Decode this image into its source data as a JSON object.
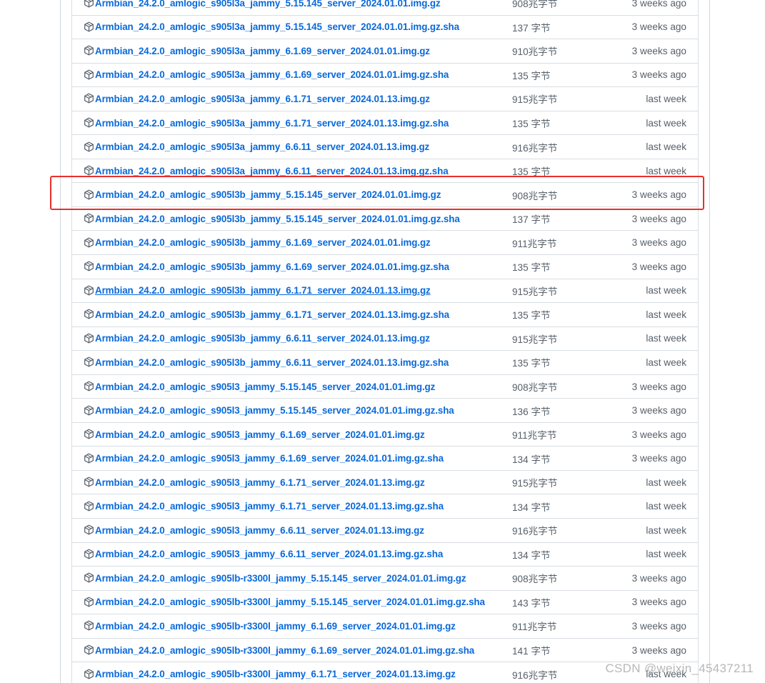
{
  "assets": [
    {
      "name": "Armbian_24.2.0_amlogic_s905l3a_jammy_5.15.145_server_2024.01.01.img.gz",
      "size": "908兆字节",
      "time": "3 weeks ago"
    },
    {
      "name": "Armbian_24.2.0_amlogic_s905l3a_jammy_5.15.145_server_2024.01.01.img.gz.sha",
      "size": "137 字节",
      "time": "3 weeks ago"
    },
    {
      "name": "Armbian_24.2.0_amlogic_s905l3a_jammy_6.1.69_server_2024.01.01.img.gz",
      "size": "910兆字节",
      "time": "3 weeks ago"
    },
    {
      "name": "Armbian_24.2.0_amlogic_s905l3a_jammy_6.1.69_server_2024.01.01.img.gz.sha",
      "size": "135 字节",
      "time": "3 weeks ago"
    },
    {
      "name": "Armbian_24.2.0_amlogic_s905l3a_jammy_6.1.71_server_2024.01.13.img.gz",
      "size": "915兆字节",
      "time": "last week"
    },
    {
      "name": "Armbian_24.2.0_amlogic_s905l3a_jammy_6.1.71_server_2024.01.13.img.gz.sha",
      "size": "135 字节",
      "time": "last week"
    },
    {
      "name": "Armbian_24.2.0_amlogic_s905l3a_jammy_6.6.11_server_2024.01.13.img.gz",
      "size": "916兆字节",
      "time": "last week"
    },
    {
      "name": "Armbian_24.2.0_amlogic_s905l3a_jammy_6.6.11_server_2024.01.13.img.gz.sha",
      "size": "135 字节",
      "time": "last week"
    },
    {
      "name": "Armbian_24.2.0_amlogic_s905l3b_jammy_5.15.145_server_2024.01.01.img.gz",
      "size": "908兆字节",
      "time": "3 weeks ago"
    },
    {
      "name": "Armbian_24.2.0_amlogic_s905l3b_jammy_5.15.145_server_2024.01.01.img.gz.sha",
      "size": "137 字节",
      "time": "3 weeks ago"
    },
    {
      "name": "Armbian_24.2.0_amlogic_s905l3b_jammy_6.1.69_server_2024.01.01.img.gz",
      "size": "911兆字节",
      "time": "3 weeks ago"
    },
    {
      "name": "Armbian_24.2.0_amlogic_s905l3b_jammy_6.1.69_server_2024.01.01.img.gz.sha",
      "size": "135 字节",
      "time": "3 weeks ago"
    },
    {
      "name": "Armbian_24.2.0_amlogic_s905l3b_jammy_6.1.71_server_2024.01.13.img.gz",
      "size": "915兆字节",
      "time": "last week"
    },
    {
      "name": "Armbian_24.2.0_amlogic_s905l3b_jammy_6.1.71_server_2024.01.13.img.gz.sha",
      "size": "135 字节",
      "time": "last week"
    },
    {
      "name": "Armbian_24.2.0_amlogic_s905l3b_jammy_6.6.11_server_2024.01.13.img.gz",
      "size": "915兆字节",
      "time": "last week"
    },
    {
      "name": "Armbian_24.2.0_amlogic_s905l3b_jammy_6.6.11_server_2024.01.13.img.gz.sha",
      "size": "135 字节",
      "time": "last week"
    },
    {
      "name": "Armbian_24.2.0_amlogic_s905l3_jammy_5.15.145_server_2024.01.01.img.gz",
      "size": "908兆字节",
      "time": "3 weeks ago"
    },
    {
      "name": "Armbian_24.2.0_amlogic_s905l3_jammy_5.15.145_server_2024.01.01.img.gz.sha",
      "size": "136 字节",
      "time": "3 weeks ago"
    },
    {
      "name": "Armbian_24.2.0_amlogic_s905l3_jammy_6.1.69_server_2024.01.01.img.gz",
      "size": "911兆字节",
      "time": "3 weeks ago"
    },
    {
      "name": "Armbian_24.2.0_amlogic_s905l3_jammy_6.1.69_server_2024.01.01.img.gz.sha",
      "size": "134 字节",
      "time": "3 weeks ago"
    },
    {
      "name": "Armbian_24.2.0_amlogic_s905l3_jammy_6.1.71_server_2024.01.13.img.gz",
      "size": "915兆字节",
      "time": "last week"
    },
    {
      "name": "Armbian_24.2.0_amlogic_s905l3_jammy_6.1.71_server_2024.01.13.img.gz.sha",
      "size": "134 字节",
      "time": "last week"
    },
    {
      "name": "Armbian_24.2.0_amlogic_s905l3_jammy_6.6.11_server_2024.01.13.img.gz",
      "size": "916兆字节",
      "time": "last week"
    },
    {
      "name": "Armbian_24.2.0_amlogic_s905l3_jammy_6.6.11_server_2024.01.13.img.gz.sha",
      "size": "134 字节",
      "time": "last week"
    },
    {
      "name": "Armbian_24.2.0_amlogic_s905lb-r3300l_jammy_5.15.145_server_2024.01.01.img.gz",
      "size": "908兆字节",
      "time": "3 weeks ago"
    },
    {
      "name": "Armbian_24.2.0_amlogic_s905lb-r3300l_jammy_5.15.145_server_2024.01.01.img.gz.sha",
      "size": "143 字节",
      "time": "3 weeks ago"
    },
    {
      "name": "Armbian_24.2.0_amlogic_s905lb-r3300l_jammy_6.1.69_server_2024.01.01.img.gz",
      "size": "911兆字节",
      "time": "3 weeks ago"
    },
    {
      "name": "Armbian_24.2.0_amlogic_s905lb-r3300l_jammy_6.1.69_server_2024.01.01.img.gz.sha",
      "size": "141 字节",
      "time": "3 weeks ago"
    },
    {
      "name": "Armbian_24.2.0_amlogic_s905lb-r3300l_jammy_6.1.71_server_2024.01.13.img.gz",
      "size": "916兆字节",
      "time": "last week"
    }
  ],
  "highlighted_index": 8,
  "hovered_index": 12,
  "icon": "package-icon",
  "watermark": "CSDN @weixin_45437211",
  "colors": {
    "link": "#0969da",
    "muted": "#57606a",
    "border": "#d8dee4",
    "highlight": "#e8302b"
  }
}
